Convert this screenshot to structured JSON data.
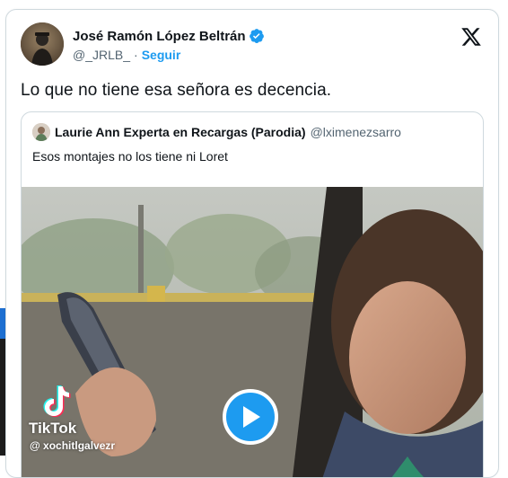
{
  "tweet": {
    "author_name": "José Ramón López Beltrán",
    "handle": "@_JRLB_",
    "separator": "·",
    "follow_label": "Seguir",
    "text": "Lo que no tiene esa señora es decencia."
  },
  "quote": {
    "author_name": "Laurie Ann Experta en Recargas (Parodia)",
    "handle": "@lximenezsarro",
    "text": "Esos montajes no los tiene ni Loret"
  },
  "video": {
    "watermark_brand": "TikTok",
    "watermark_user": "@ xochitlgalvezr"
  },
  "colors": {
    "accent": "#1d9bf0",
    "text_primary": "#0f1419",
    "text_secondary": "#536471",
    "border": "#cfd9de"
  },
  "icons": [
    "verified-badge-icon",
    "x-logo-icon",
    "play-icon",
    "tiktok-icon"
  ]
}
